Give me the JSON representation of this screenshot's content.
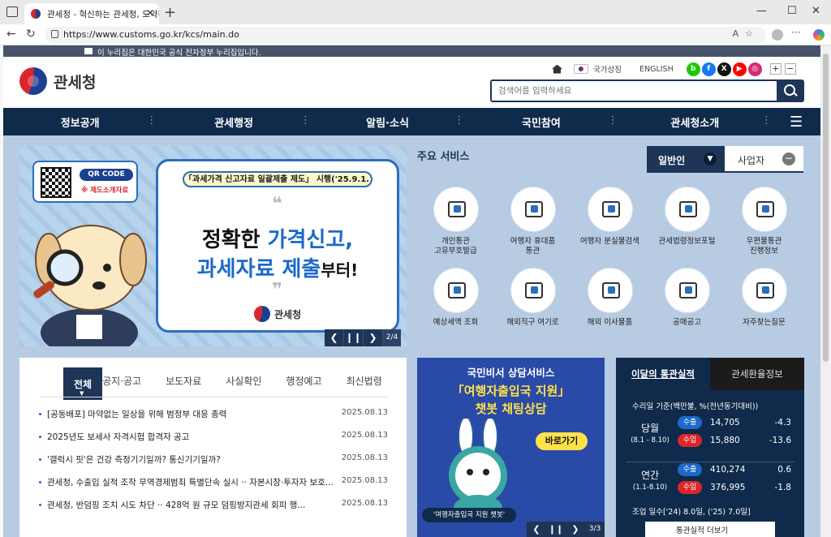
{
  "browser": {
    "tab_title": "관세청 - 혁신하는 관세청, 도약하",
    "url": "https://www.customs.go.kr/kcs/main.do"
  },
  "govbar": {
    "text": "이 누리집은 대한민국 공식 전자정부 누리집입니다."
  },
  "header": {
    "logo_text": "관세청",
    "national_symbol": "국가상징",
    "english": "ENGLISH",
    "search_placeholder": "검색어를 입력하세요",
    "zoom_in": "+",
    "zoom_out": "−"
  },
  "gnb": [
    "정보공개",
    "관세행정",
    "알림·소식",
    "국민참여",
    "관세청소개"
  ],
  "banner": {
    "qr_label": "QR CODE",
    "qr_sub": "※ 제도소개자료",
    "pill": "「과세가격 신고자료 일괄제출 제도」 시행('25.9.1.)",
    "line1a": "정확한 ",
    "line1b": "가격신고,",
    "line2a": "과세자료 제출",
    "line2b": "부터!",
    "brand": "관세청",
    "counter": "2/4"
  },
  "services": {
    "title": "주요 서비스",
    "tab_personal": "일반인",
    "tab_business": "사업자",
    "items": [
      {
        "l1": "개인통관",
        "l2": "고유부호발급"
      },
      {
        "l1": "여행자 휴대품",
        "l2": "통관"
      },
      {
        "l1": "여행자 분실물검색",
        "l2": ""
      },
      {
        "l1": "관세법령정보포털",
        "l2": ""
      },
      {
        "l1": "우편물통관",
        "l2": "진행정보"
      },
      {
        "l1": "예상세액 조회",
        "l2": ""
      },
      {
        "l1": "해외직구 여기로",
        "l2": ""
      },
      {
        "l1": "해외 이사물품",
        "l2": ""
      },
      {
        "l1": "공매공고",
        "l2": ""
      },
      {
        "l1": "자주찾는질문",
        "l2": ""
      }
    ]
  },
  "news": {
    "tabs": [
      "전체",
      "공지·공고",
      "보도자료",
      "사실확인",
      "행정예고",
      "최신법령"
    ],
    "items": [
      {
        "title": "[공동배포] 마약없는 일상을 위해 범정부 대응 총력",
        "date": "2025.08.13"
      },
      {
        "title": "2025년도 보세사 자격시험 합격자 공고",
        "date": "2025.08.13"
      },
      {
        "title": "'갤럭시 핏'은 건강 측정기기일까? 통신기기일까?",
        "date": "2025.08.13"
      },
      {
        "title": "관세청, 수출입 실적 조작 무역경제범죄 특별단속 실시 ·· 자본시장·투자자 보호...",
        "date": "2025.08.13"
      },
      {
        "title": "관세청, 반덤핑 조치 시도 차단 ·· 428억 원 규모 덤핑방지관세 회피 행...",
        "date": "2025.08.13"
      }
    ]
  },
  "promo": {
    "line1": "국민비서 상담서비스",
    "line2": "「여행자출입국 지원」",
    "line3": "챗봇 채팅상담",
    "go": "바로가기",
    "caption": "'여행자출입국 지원 챗봇'",
    "counter": "3/3"
  },
  "stats": {
    "tab_on": "이달의 통관실적",
    "tab_off": "관세환율정보",
    "note": "수리일 기준(백만불, %(전년동기대비))",
    "month_label": "당월",
    "month_range": "(8.1 - 8.10)",
    "year_label": "연간",
    "year_range": "(1.1-8.10)",
    "export": "수출",
    "import": "수입",
    "month_export": "14,705",
    "month_export_pct": "-4.3",
    "month_import": "15,880",
    "month_import_pct": "-13.6",
    "year_export": "410,274",
    "year_export_pct": "0.6",
    "year_import": "376,995",
    "year_import_pct": "-1.8",
    "ops": "조업 일수['24) 8.0일, ('25) 7.0일]",
    "more": "통관실적 더보기"
  },
  "colors": {
    "navy": "#0f2a4a",
    "accent": "#1c69c9",
    "red": "#d9262c",
    "yellow": "#ffe24a"
  }
}
